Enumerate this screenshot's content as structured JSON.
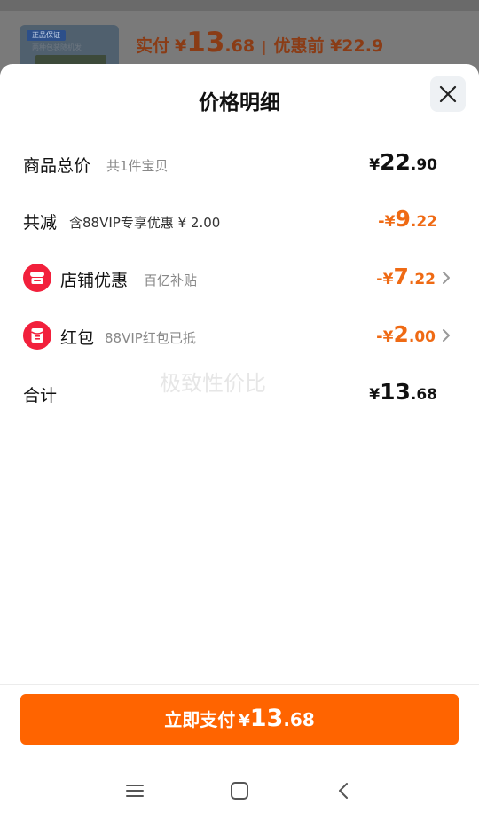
{
  "background": {
    "thumb_tag": "正品保证",
    "thumb_sub": "两种包装随机发",
    "price_label": "实付",
    "price_symbol": "¥",
    "price_int": "13",
    "price_dec": ".68",
    "separator": "|",
    "pre_price": "优惠前 ¥22.9"
  },
  "sheet": {
    "title": "价格明细",
    "close_icon": "close-icon"
  },
  "rows": {
    "total": {
      "label": "商品总价",
      "desc": "共1件宝贝",
      "sign": "",
      "symbol": "¥",
      "int": "22",
      "dec": ".90"
    },
    "reduce": {
      "label": "共减",
      "desc": "含88VIP专享优惠 ¥ 2.00",
      "sign": "-",
      "symbol": "¥",
      "int": "9",
      "dec": ".22"
    },
    "shop": {
      "label": "店铺优惠",
      "desc": "百亿补贴",
      "sign": "-",
      "symbol": "¥",
      "int": "7",
      "dec": ".22",
      "icon": "store-icon"
    },
    "redpacket": {
      "label": "红包",
      "desc": "88VIP红包已抵",
      "sign": "-",
      "symbol": "¥",
      "int": "2",
      "dec": ".00",
      "icon": "red-packet-icon"
    },
    "sum": {
      "label": "合计",
      "symbol": "¥",
      "int": "13",
      "dec": ".68"
    }
  },
  "watermark": "极致性价比",
  "footer": {
    "pay_label": "立即支付",
    "symbol": "¥",
    "int": "13",
    "dec": ".68"
  },
  "colors": {
    "accent": "#ff6400",
    "discount": "#ef6a14",
    "icon_red": "#f2203c"
  },
  "navbar": {
    "menu_icon": "menu-icon",
    "home_icon": "home-icon",
    "back_icon": "back-icon"
  }
}
